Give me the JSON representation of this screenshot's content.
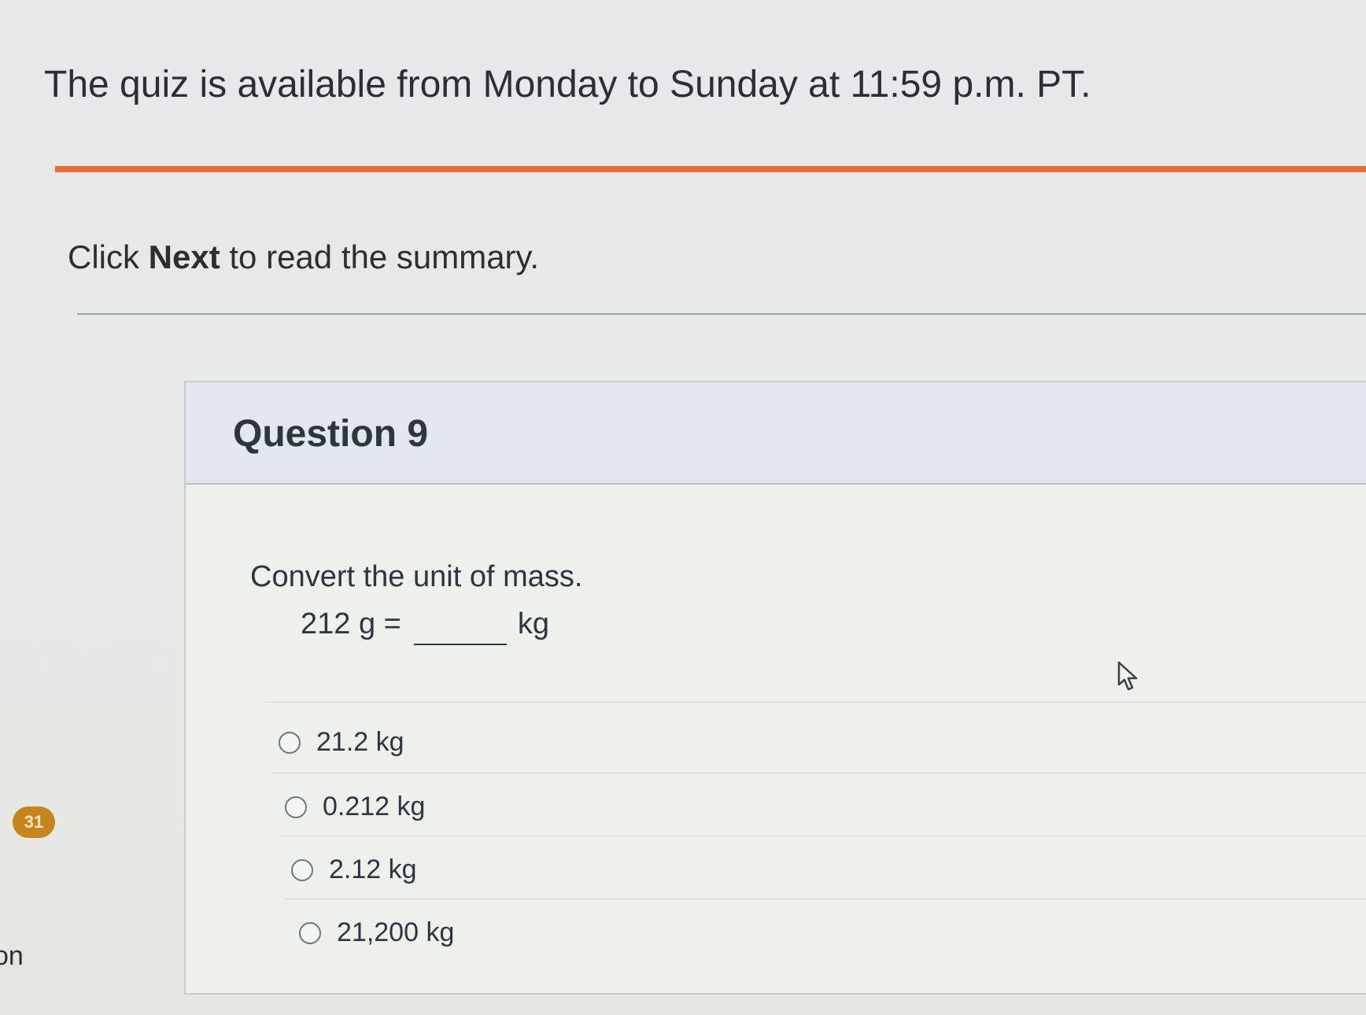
{
  "availability_notice": "The quiz is available from Monday to Sunday at 11:59 p.m. PT.",
  "instruction": {
    "prefix": "Click ",
    "emphasis": "Next",
    "suffix": " to read the summary."
  },
  "question": {
    "title": "Question 9",
    "prompt": "Convert the unit of mass.",
    "equation_left": "212 g =",
    "equation_unit": "kg",
    "answers": [
      {
        "label": "21.2 kg"
      },
      {
        "label": "0.212 kg"
      },
      {
        "label": "2.12 kg"
      },
      {
        "label": "21,200 kg"
      }
    ]
  },
  "side_badge": "31",
  "edge_text": "on",
  "colors": {
    "accent_rule": "#e36f3c",
    "header_bg": "#e1e7ec",
    "badge": "#c7841e"
  }
}
